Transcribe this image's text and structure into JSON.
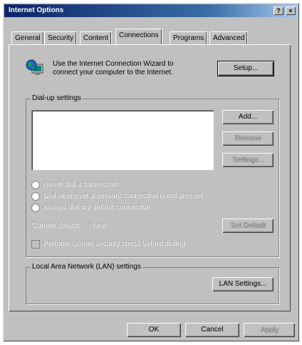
{
  "window": {
    "title": "Internet Options"
  },
  "titlebar_buttons": {
    "help": "?",
    "close": "×"
  },
  "tabs": [
    {
      "label": "General"
    },
    {
      "label": "Security"
    },
    {
      "label": "Content"
    },
    {
      "label": "Connections"
    },
    {
      "label": "Programs"
    },
    {
      "label": "Advanced"
    }
  ],
  "wizard": {
    "text_line1": "Use the Internet Connection Wizard to",
    "text_line2": "connect your computer to the Internet.",
    "setup_label": "Setup..."
  },
  "dialup": {
    "legend": "Dial-up settings",
    "add_label": "Add...",
    "remove_label": "Remove",
    "settings_label": "Settings...",
    "radio1": "Never dial a connection",
    "radio2": "Dial whenever a network connection is not present",
    "radio3": "Always dial my default connection",
    "current_default_label": "Current default:",
    "current_default_value": "None",
    "set_default_label": "Set Default",
    "check_label": "Perform system security check before dialing"
  },
  "lan": {
    "legend": "Local Area Network (LAN) settings",
    "lan_settings_label": "LAN Settings..."
  },
  "footer": {
    "ok_label": "OK",
    "cancel_label": "Cancel",
    "apply_label": "Apply"
  }
}
